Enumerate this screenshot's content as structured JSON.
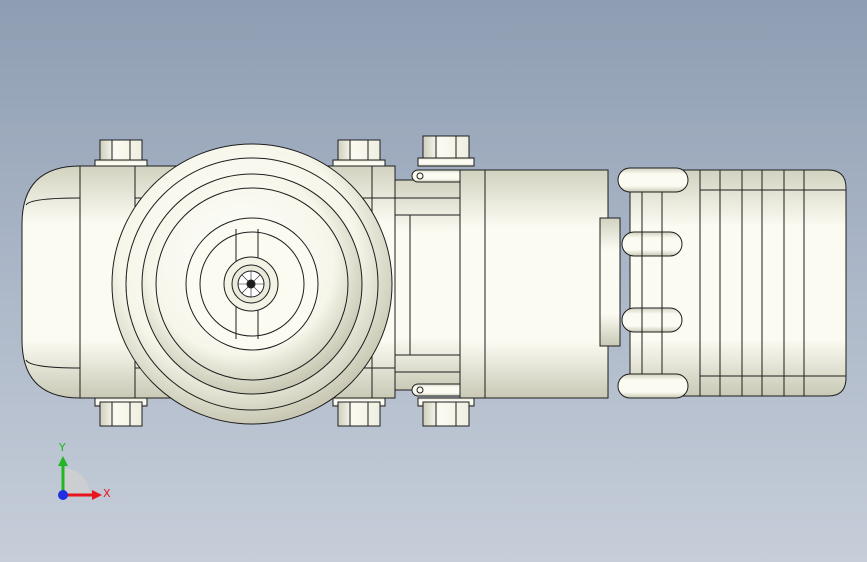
{
  "viewport": {
    "background_top": "#8e9db2",
    "background_bottom": "#c6ced9",
    "part_fill": "#fbfbf2",
    "part_shade": "#d9d9c9",
    "edge_color": "#1e1e1e"
  },
  "triad": {
    "x_label": "X",
    "y_label": "Y",
    "x_color": "#e8141e",
    "y_color": "#22b622",
    "z_color": "#1f2ee0"
  },
  "model": {
    "name_icon": "caster-wheel-top-view",
    "components": [
      "housing",
      "wheel",
      "hub",
      "bolts",
      "hinge-plates",
      "ribbed-clamp"
    ]
  }
}
